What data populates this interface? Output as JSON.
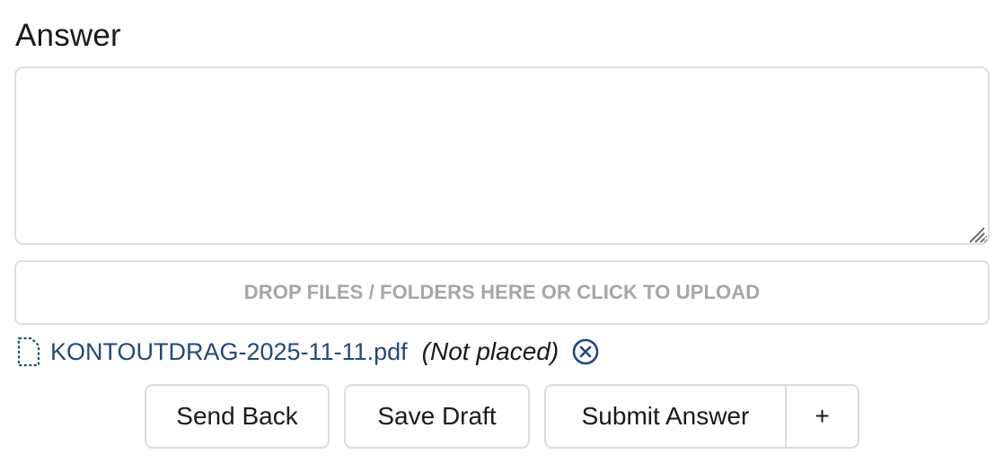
{
  "answer_section": {
    "heading": "Answer",
    "textarea_value": "",
    "textarea_placeholder": ""
  },
  "upload": {
    "dropzone_label": "DROP FILES / FOLDERS HERE OR CLICK TO UPLOAD"
  },
  "attachments": [
    {
      "icon": "file-icon",
      "name": "KONTOUTDRAG-2025-11-11.pdf",
      "status": "(Not placed)",
      "remove_icon": "remove-circle-x-icon"
    }
  ],
  "actions": {
    "send_back_label": "Send Back",
    "save_draft_label": "Save Draft",
    "submit_label": "Submit Answer",
    "more_label": "+"
  },
  "colors": {
    "link": "#1f4a7a",
    "border": "#dedede",
    "muted_text": "#a6a6a6"
  }
}
